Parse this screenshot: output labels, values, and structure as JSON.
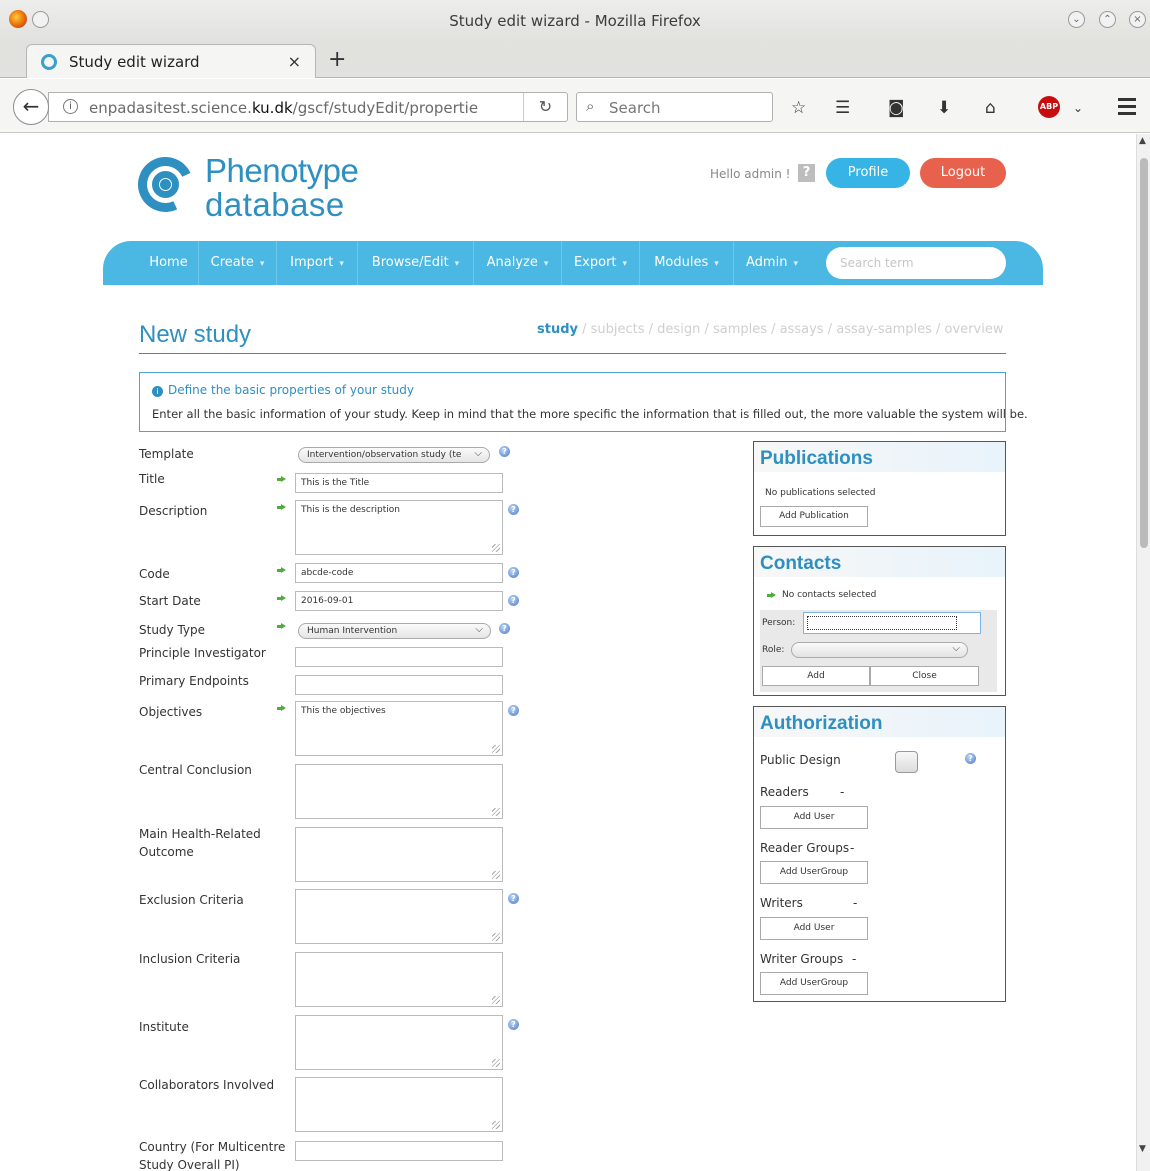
{
  "window": {
    "title": "Study edit wizard - Mozilla Firefox"
  },
  "tab": {
    "label": "Study edit wizard",
    "close": "×",
    "new": "+"
  },
  "browser": {
    "url_prefix": "enpadasitest.science.",
    "url_domain": "ku.dk",
    "url_suffix": "/gscf/studyEdit/propertie",
    "search_placeholder": "Search",
    "abp": "ABP"
  },
  "header": {
    "brand_line1": "Phenotype",
    "brand_line2": "database",
    "greeting": "Hello admin !",
    "help": "?",
    "profile": "Profile",
    "logout": "Logout"
  },
  "nav": {
    "items": [
      {
        "label": "Home"
      },
      {
        "label": "Create"
      },
      {
        "label": "Import"
      },
      {
        "label": "Browse/Edit"
      },
      {
        "label": "Analyze"
      },
      {
        "label": "Export"
      },
      {
        "label": "Modules"
      },
      {
        "label": "Admin"
      }
    ],
    "search_placeholder": "Search term"
  },
  "page": {
    "title": "New study",
    "steps_active": "study",
    "steps_rest": " / subjects / design / samples / assays / assay-samples / overview"
  },
  "info": {
    "heading": "Define the basic properties of your study",
    "text": "Enter all the basic information of your study. Keep in mind that the more specific the information that is filled out, the more valuable the system will be."
  },
  "form": {
    "template_label": "Template",
    "template_value": "Intervention/observation study (te",
    "title_label": "Title",
    "title_value": "This is the Title",
    "description_label": "Description",
    "description_value": "This is the description",
    "code_label": "Code",
    "code_value": "abcde-code",
    "start_date_label": "Start Date",
    "start_date_value": "2016-09-01",
    "study_type_label": "Study Type",
    "study_type_value": "Human Intervention",
    "pi_label": "Principle Investigator",
    "pi_value": "",
    "endpoints_label": "Primary Endpoints",
    "endpoints_value": "",
    "objectives_label": "Objectives",
    "objectives_value": "This the objectives",
    "conclusion_label": "Central Conclusion",
    "health_label_1": "Main Health-Related",
    "health_label_2": "Outcome",
    "exclusion_label": "Exclusion Criteria",
    "inclusion_label": "Inclusion Criteria",
    "institute_label": "Institute",
    "collaborators_label": "Collaborators Involved",
    "country_label_1": "Country (For Multicentre",
    "country_label_2": "Study Overall PI)",
    "country_value": ""
  },
  "publications": {
    "title": "Publications",
    "empty": "No publications selected",
    "add": "Add Publication"
  },
  "contacts": {
    "title": "Contacts",
    "empty": "No contacts selected",
    "person_label": "Person:",
    "role_label": "Role:",
    "add": "Add",
    "close": "Close"
  },
  "authorization": {
    "title": "Authorization",
    "public_design": "Public Design",
    "readers": "Readers",
    "readers_value": "-",
    "add_user": "Add User",
    "reader_groups": "Reader Groups",
    "reader_groups_value": "-",
    "add_usergroup": "Add UserGroup",
    "writers": "Writers",
    "writers_value": "-",
    "writer_groups": "Writer Groups",
    "writer_groups_value": "-"
  }
}
